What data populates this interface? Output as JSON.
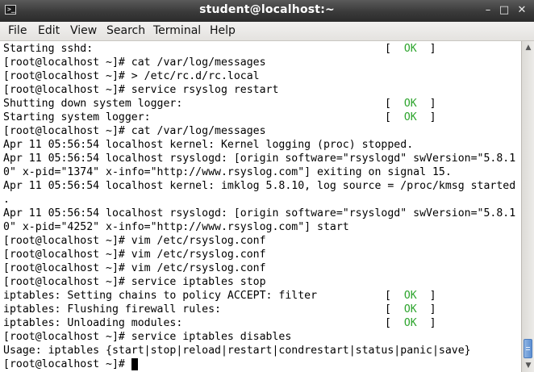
{
  "window": {
    "title": "student@localhost:~",
    "controls": {
      "minimize": "–",
      "maximize": "□",
      "close": "✕"
    }
  },
  "menubar": [
    "File",
    "Edit",
    "View",
    "Search",
    "Terminal",
    "Help"
  ],
  "terminal": {
    "lines": [
      "Starting sshd:",
      "[root@localhost ~]# cat /var/log/messages",
      "[root@localhost ~]# > /etc/rc.d/rc.local",
      "[root@localhost ~]# service rsyslog restart",
      "Shutting down system logger:",
      "Starting system logger:",
      "[root@localhost ~]# cat /var/log/messages",
      "Apr 11 05:56:54 localhost kernel: Kernel logging (proc) stopped.",
      "Apr 11 05:56:54 localhost rsyslogd: [origin software=\"rsyslogd\" swVersion=\"5.8.1",
      "0\" x-pid=\"1374\" x-info=\"http://www.rsyslog.com\"] exiting on signal 15.",
      "Apr 11 05:56:54 localhost kernel: imklog 5.8.10, log source = /proc/kmsg started",
      ".",
      "Apr 11 05:56:54 localhost rsyslogd: [origin software=\"rsyslogd\" swVersion=\"5.8.1",
      "0\" x-pid=\"4252\" x-info=\"http://www.rsyslog.com\"] start",
      "[root@localhost ~]# vim /etc/rsyslog.conf",
      "[root@localhost ~]# vim /etc/rsyslog.conf",
      "[root@localhost ~]# vim /etc/rsyslog.conf",
      "[root@localhost ~]# service iptables stop",
      "iptables: Setting chains to policy ACCEPT: filter",
      "iptables: Flushing firewall rules:",
      "iptables: Unloading modules:",
      "[root@localhost ~]# service iptables disables",
      "Usage: iptables {start|stop|reload|restart|condrestart|status|panic|save}",
      "[root@localhost ~]# "
    ],
    "status_lines": [
      0,
      4,
      5,
      18,
      19,
      20
    ],
    "status": {
      "open": "[  ",
      "ok": "OK",
      "close": "  ]"
    }
  },
  "colors": {
    "ok": "#2ea52e",
    "titlebar": "#3a3a3a",
    "scroll_thumb": "#5d8fd1"
  }
}
